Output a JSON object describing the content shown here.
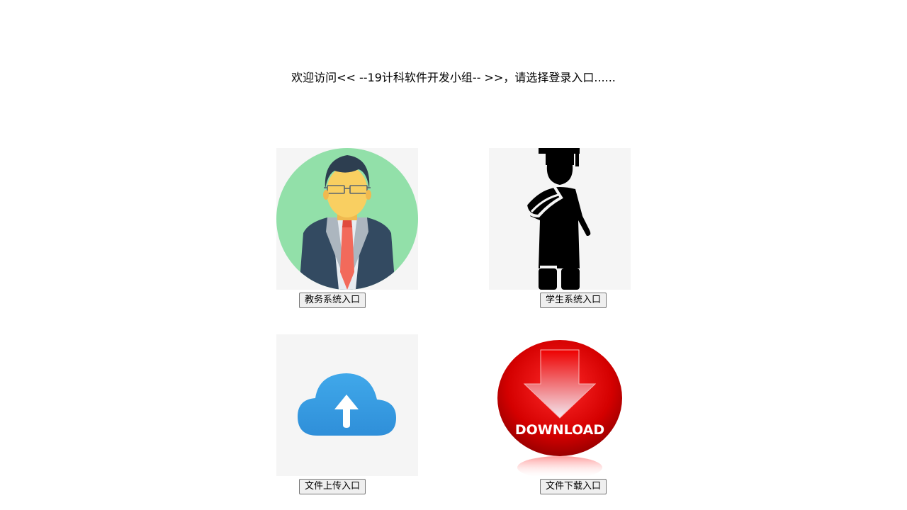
{
  "welcome_text": "欢迎访问<< --19计科软件开发小组-- >>，请选择登录入口......",
  "entries": {
    "teacher": {
      "label": "教务系统入口",
      "icon": "teacher-avatar-icon"
    },
    "student": {
      "label": "学生系统入口",
      "icon": "graduate-student-icon"
    },
    "upload": {
      "label": "文件上传入口",
      "icon": "cloud-upload-icon"
    },
    "download": {
      "label": "文件下载入口",
      "icon": "download-button-icon",
      "icon_text": "DOWNLOAD"
    }
  },
  "colors": {
    "teacher_circle": "#92e0a9",
    "suit": "#334a61",
    "tie": "#f26a5b",
    "face": "#f9cf61",
    "cloud": "#3a9be0",
    "download_red": "#e00000"
  }
}
